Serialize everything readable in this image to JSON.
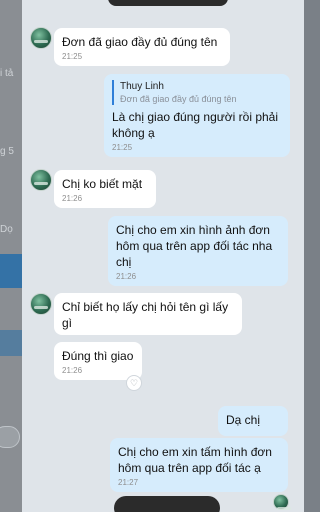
{
  "background_app": {
    "fragments": [
      "i tả",
      "g 5",
      "Dọ"
    ]
  },
  "messages": [
    {
      "text": "Đơn đã giao đầy đủ đúng tên",
      "time": "21:25"
    },
    {
      "quote_name": "Thuy Linh",
      "quote_text": "Đơn đã giao đầy đủ đúng tên",
      "text": "Là chị giao đúng người rồi phải không ạ",
      "time": "21:25"
    },
    {
      "text": "Chị ko biết mặt",
      "time": "21:26"
    },
    {
      "text": "Chị cho em xin hình ảnh đơn hôm qua trên app đối tác nha chị",
      "time": "21:26"
    },
    {
      "text": "Chỉ biết họ lấy chị hỏi tên gì lấy gì"
    },
    {
      "text": "Đúng thì giao",
      "time": "21:26"
    },
    {
      "text": "Dạ chị"
    },
    {
      "text": "Chị cho em xin tấm hình đơn hôm qua trên app đối tác ạ",
      "time": "21:27"
    }
  ],
  "icons": {
    "react": "heart-icon",
    "avatar": "avatar"
  },
  "colors": {
    "incoming_bubble": "#ffffff",
    "outgoing_bubble": "#d6ecfc",
    "chat_background": "#dfe4e9",
    "quote_bar": "#2f7fd8"
  }
}
